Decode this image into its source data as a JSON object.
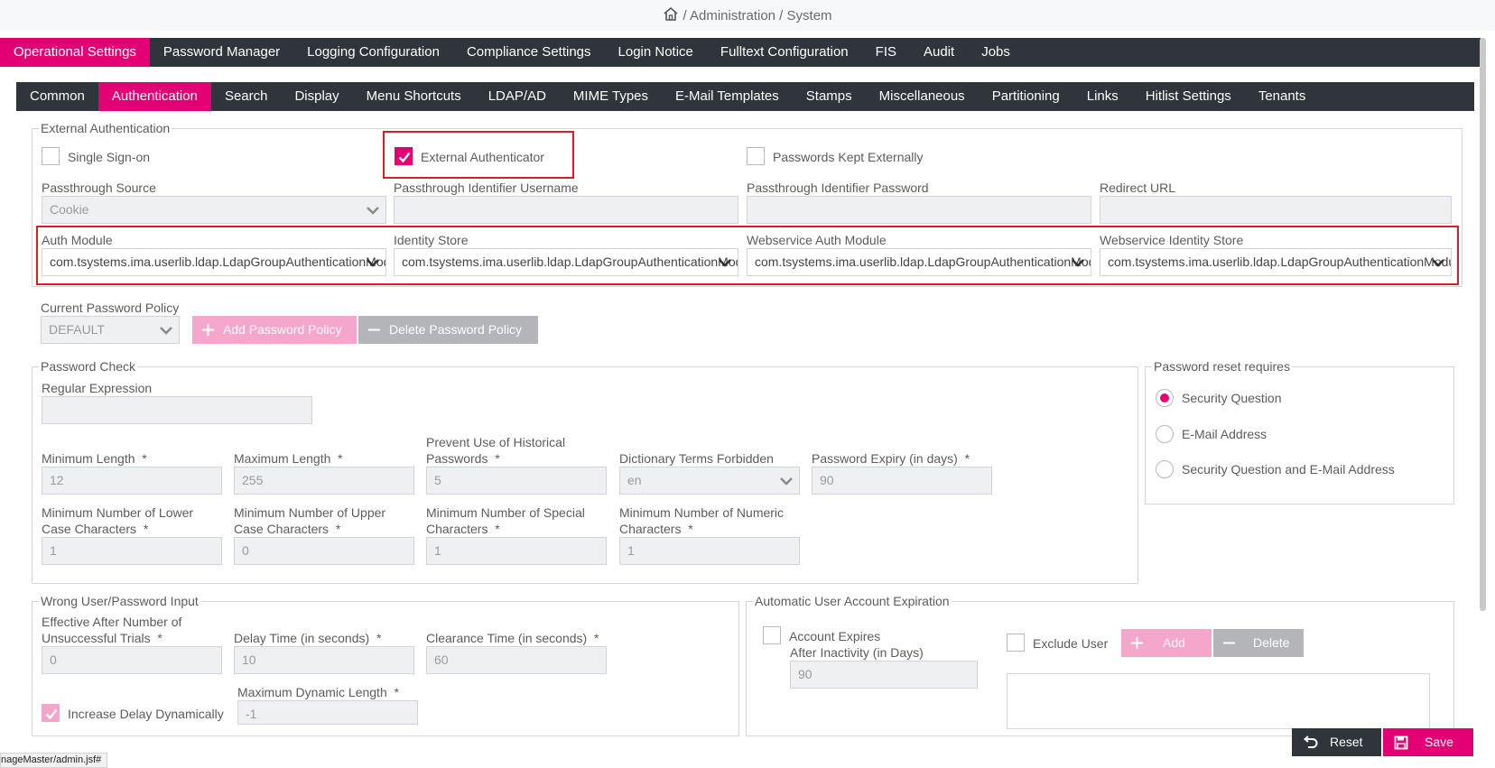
{
  "breadcrumb": {
    "path": "/ Administration / System"
  },
  "main_tabs": [
    {
      "label": "Operational Settings",
      "active": true
    },
    {
      "label": "Password Manager"
    },
    {
      "label": "Logging Configuration"
    },
    {
      "label": "Compliance Settings"
    },
    {
      "label": "Login Notice"
    },
    {
      "label": "Fulltext Configuration"
    },
    {
      "label": "FIS"
    },
    {
      "label": "Audit"
    },
    {
      "label": "Jobs"
    }
  ],
  "sub_tabs": [
    {
      "label": "Common"
    },
    {
      "label": "Authentication",
      "active": true
    },
    {
      "label": "Search"
    },
    {
      "label": "Display"
    },
    {
      "label": "Menu Shortcuts"
    },
    {
      "label": "LDAP/AD"
    },
    {
      "label": "MIME Types"
    },
    {
      "label": "E-Mail Templates"
    },
    {
      "label": "Stamps"
    },
    {
      "label": "Miscellaneous"
    },
    {
      "label": "Partitioning"
    },
    {
      "label": "Links"
    },
    {
      "label": "Hitlist Settings"
    },
    {
      "label": "Tenants"
    }
  ],
  "external_auth": {
    "legend": "External Authentication",
    "single_sign_on": {
      "label": "Single Sign-on",
      "checked": false
    },
    "external_authenticator": {
      "label": "External Authenticator",
      "checked": true
    },
    "passwords_kept_externally": {
      "label": "Passwords Kept Externally",
      "checked": false
    },
    "passthrough_source": {
      "label": "Passthrough Source",
      "value": "Cookie"
    },
    "passthrough_identifier_username": {
      "label": "Passthrough Identifier Username",
      "value": ""
    },
    "passthrough_identifier_password": {
      "label": "Passthrough Identifier Password",
      "value": ""
    },
    "redirect_url": {
      "label": "Redirect URL",
      "value": ""
    },
    "auth_module": {
      "label": "Auth Module",
      "value": "com.tsystems.ima.userlib.ldap.LdapGroupAuthenticationModule"
    },
    "identity_store": {
      "label": "Identity Store",
      "value": "com.tsystems.ima.userlib.ldap.LdapGroupAuthenticationModule"
    },
    "webservice_auth_module": {
      "label": "Webservice Auth Module",
      "value": "com.tsystems.ima.userlib.ldap.LdapGroupAuthenticationModule"
    },
    "webservice_identity_store": {
      "label": "Webservice Identity Store",
      "value": "com.tsystems.ima.userlib.ldap.LdapGroupAuthenticationModule"
    }
  },
  "password_policy": {
    "label": "Current Password Policy",
    "value": "DEFAULT",
    "add_label": "Add Password Policy",
    "delete_label": "Delete Password Policy"
  },
  "password_check": {
    "legend": "Password Check",
    "regex": {
      "label": "Regular Expression",
      "value": ""
    },
    "min_length": {
      "label": "Minimum Length",
      "value": "12"
    },
    "max_length": {
      "label": "Maximum Length",
      "value": "255"
    },
    "historical": {
      "label_line1": "Prevent Use of Historical",
      "label_line2": "Passwords",
      "value": "5"
    },
    "dictionary": {
      "label": "Dictionary Terms Forbidden",
      "value": "en"
    },
    "expiry": {
      "label": "Password Expiry (in days)",
      "value": "90"
    },
    "min_lower": {
      "label_line1": "Minimum Number of Lower",
      "label_line2": "Case Characters",
      "value": "1"
    },
    "min_upper": {
      "label_line1": "Minimum Number of Upper",
      "label_line2": "Case Characters",
      "value": "0"
    },
    "min_special": {
      "label_line1": "Minimum Number of Special",
      "label_line2": "Characters",
      "value": "1"
    },
    "min_numeric": {
      "label_line1": "Minimum Number of Numeric",
      "label_line2": "Characters",
      "value": "1"
    }
  },
  "reset_requires": {
    "legend": "Password reset requires",
    "options": [
      {
        "label": "Security Question",
        "checked": true
      },
      {
        "label": "E-Mail Address",
        "checked": false
      },
      {
        "label": "Security Question and E-Mail Address",
        "checked": false
      }
    ]
  },
  "wrong_input": {
    "legend": "Wrong User/Password Input",
    "effective_after": {
      "label_line1": "Effective After Number of",
      "label_line2": "Unsuccessful Trials",
      "value": "0"
    },
    "delay_time": {
      "label": "Delay Time (in seconds)",
      "value": "10"
    },
    "clearance_time": {
      "label": "Clearance Time (in seconds)",
      "value": "60"
    },
    "increase_delay": {
      "label": "Increase Delay Dynamically",
      "checked": true
    },
    "max_dynamic_length": {
      "label": "Maximum Dynamic Length",
      "value": "-1"
    }
  },
  "auto_expiration": {
    "legend": "Automatic User Account Expiration",
    "account_expires": {
      "label": "Account Expires",
      "checked": false
    },
    "after_inactivity": {
      "label": "After Inactivity (in Days)",
      "value": "90"
    },
    "exclude_user": {
      "label": "Exclude User",
      "checked": false
    },
    "add_label": "Add",
    "delete_label": "Delete"
  },
  "footer": {
    "reset_label": "Reset",
    "save_label": "Save",
    "status_url": "nageMaster/admin.jsf#"
  },
  "required_marker": "*",
  "colors": {
    "accent": "#e20074",
    "nav_bg": "#2f353b",
    "highlight": "#d71f25"
  }
}
